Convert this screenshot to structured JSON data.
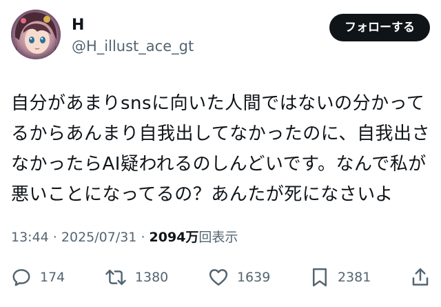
{
  "user": {
    "display_name": "H",
    "handle": "@H_illust_ace_gt"
  },
  "follow_button": {
    "label": "フォローする"
  },
  "tweet": {
    "text": "自分があまりsnsに向いた人間ではないの分かってるからあんまり自我出してなかったのに、自我出さなかったらAI疑われるのしんどいです。なんで私が悪いことになってるの？あんたが死になさいよ"
  },
  "meta": {
    "time": "13:44",
    "separator_1": " · ",
    "date": "2025/07/31",
    "separator_2": " · ",
    "views_count": "2094万",
    "views_label": "回表示"
  },
  "actions": {
    "replies": {
      "icon": "reply-icon",
      "count": "174"
    },
    "reposts": {
      "icon": "repost-icon",
      "count": "1380"
    },
    "likes": {
      "icon": "heart-icon",
      "count": "1639"
    },
    "bookmarks": {
      "icon": "bookmark-icon",
      "count": "2381"
    },
    "share": {
      "icon": "share-icon"
    }
  },
  "colors": {
    "text_primary": "#0f1419",
    "text_secondary": "#536471",
    "button_bg": "#0f1419",
    "button_text": "#ffffff",
    "background": "#ffffff"
  }
}
